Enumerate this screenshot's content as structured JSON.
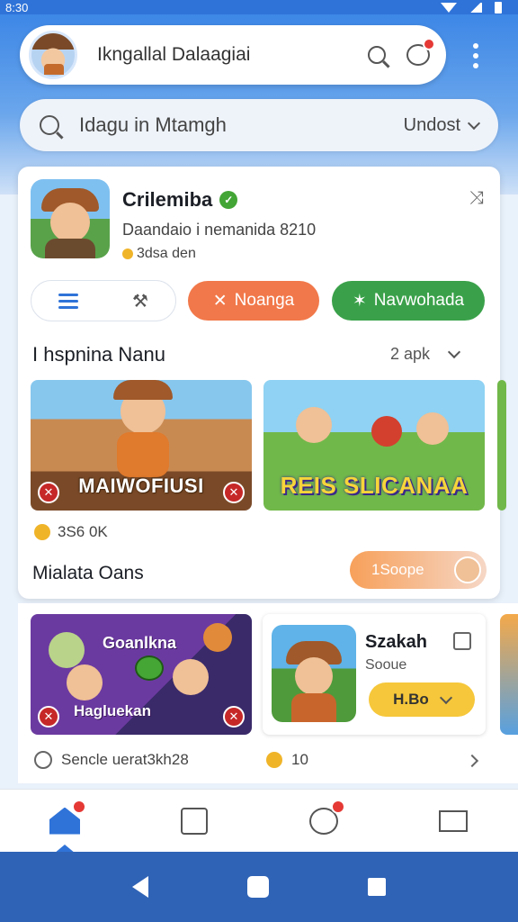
{
  "status_bar": {
    "time": "8:30"
  },
  "search_bar": {
    "text": "Ikngallal Dalaagiai"
  },
  "secondary_search": {
    "placeholder_text": "Idagu in Mtamgh",
    "filter_label": "Undost"
  },
  "profile": {
    "name": "Crilemiba",
    "subtitle": "Daandaio i nemanida 8210",
    "coins": "3dsa den"
  },
  "action_buttons": {
    "orange": "Noanga",
    "green": "Navwohada"
  },
  "section": {
    "title": "I hspnina Nanu",
    "right_label": "2 apk"
  },
  "game_tiles": [
    {
      "label": "MAIWOFIUSI"
    },
    {
      "label": "REIS SLICANAA"
    }
  ],
  "stats": {
    "text": "3S6 0K"
  },
  "card_footer": {
    "title": "Mialata Oans",
    "button_label": "1Soope"
  },
  "promo_tile": {
    "label_top": "Goanlkna",
    "label_bottom": "Hagluekan"
  },
  "app_card": {
    "title": "Szakah",
    "subtitle": "Sooue",
    "price": "H.Bo"
  },
  "row2": {
    "info_text": "Sencle uerat3kh28",
    "count": "10"
  },
  "colors": {
    "primary": "#2f73d8",
    "orange": "#f1784a",
    "green": "#3aa14a",
    "yellow": "#f6c73a"
  }
}
